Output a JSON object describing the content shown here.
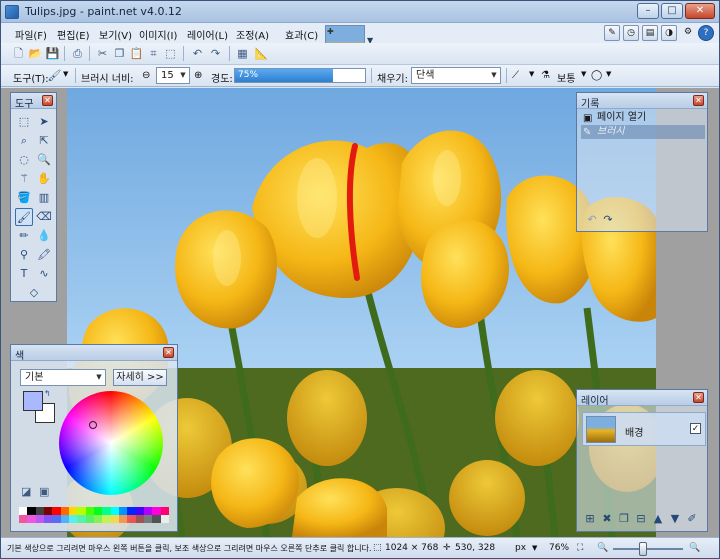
{
  "window": {
    "title": "Tulips.jpg - paint.net v4.0.12",
    "controls": {
      "minimize": "–",
      "maximize": "□",
      "close": "✕"
    }
  },
  "menu": {
    "items": [
      "파일(F)",
      "편집(E)",
      "보기(V)",
      "이미지(I)",
      "레이어(L)",
      "조정(A)",
      "효과(C)"
    ]
  },
  "toolbar": {
    "tool_label": "도구(T):",
    "brush_width_label": "브러시 너비:",
    "brush_width_value": "15",
    "hardness_label": "경도:",
    "hardness_text": "75%",
    "hardness_value": 0.75,
    "fill_label": "채우기:",
    "fill_value": "단색",
    "blend_value": "보통"
  },
  "panels": {
    "tools_title": "도구",
    "history_title": "기록",
    "history_items": [
      {
        "label": "페이지 열기",
        "icon": "open-image-icon"
      },
      {
        "label": "브러시",
        "icon": "paintbrush-icon"
      }
    ],
    "colors_title": "색",
    "colors_mode": "기본",
    "colors_more": "자세히 >>",
    "layers_title": "레이어",
    "layer_name": "배경"
  },
  "status": {
    "hint": "기본 색상으로 그리려면 마우스 왼쪽 버튼을 클릭, 보조 색상으로 그리려면 마우스 오른쪽 단추로 클릭 합니다.",
    "image_size": "1024 × 768",
    "cursor_pos": "530, 328",
    "units": "px",
    "zoom": "76%"
  },
  "colors": {
    "primary": "#aab8ff",
    "secondary": "#ffffff",
    "palette": [
      "#ffffff",
      "#000000",
      "#404040",
      "#7f0000",
      "#ff0000",
      "#ff6a00",
      "#ffd800",
      "#b6ff00",
      "#4cff00",
      "#00ff21",
      "#00ff90",
      "#00ffff",
      "#0094ff",
      "#0026ff",
      "#4800ff",
      "#b200ff",
      "#ff00dc",
      "#ff006e"
    ]
  }
}
